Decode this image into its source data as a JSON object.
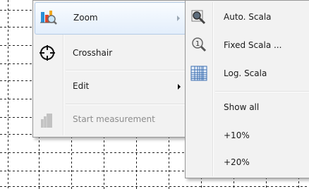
{
  "context_menu": {
    "items": [
      {
        "label": "Zoom",
        "icon": "chart-zoom-icon",
        "has_submenu": true,
        "highlighted": true,
        "enabled": true
      },
      {
        "label": "Crosshair",
        "icon": "crosshair-icon",
        "has_submenu": false,
        "highlighted": false,
        "enabled": true
      },
      {
        "label": "Edit",
        "icon": "",
        "has_submenu": true,
        "highlighted": false,
        "enabled": true
      },
      {
        "label": "Start measurement",
        "icon": "measurement-icon",
        "has_submenu": false,
        "highlighted": false,
        "enabled": false
      }
    ]
  },
  "zoom_submenu": {
    "items": [
      {
        "label": "Auto. Scala",
        "icon": "magnifier-auto-icon"
      },
      {
        "label": "Fixed Scala ...",
        "icon": "magnifier-fixed-icon"
      },
      {
        "label": "Log. Scala",
        "icon": "log-grid-icon"
      },
      {
        "label": "Show all",
        "icon": ""
      },
      {
        "label": "+10%",
        "icon": ""
      },
      {
        "label": "+20%",
        "icon": ""
      }
    ]
  },
  "colors": {
    "menu_background": "#f2f2f2",
    "highlight_border": "#b4cbe6",
    "disabled_text": "#8d8d8d",
    "grid_line": "#222222"
  }
}
